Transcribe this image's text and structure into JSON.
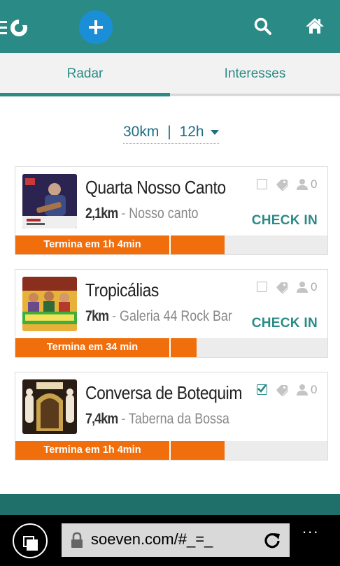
{
  "header": {
    "logo": "eventos-logo-icon",
    "add_icon": "plus-icon",
    "search_icon": "search-icon",
    "home_icon": "home-icon",
    "bar_color": "#2a8b86",
    "add_color": "#1a8fd8"
  },
  "tabs": [
    {
      "label": "Radar",
      "active": true
    },
    {
      "label": "Interesses",
      "active": false
    }
  ],
  "filter": {
    "distance": "30km",
    "separator": "|",
    "time": "12h"
  },
  "events": [
    {
      "title": "Quarta Nosso Canto",
      "distance": "2,1km",
      "separator": "-",
      "venue": "Nosso canto",
      "checked": false,
      "attendees": "0",
      "checkin_label": "CHECK IN",
      "time_left": "Termina em 1h 4min",
      "progress": 0.67
    },
    {
      "title": "Tropicálias",
      "distance": "7km",
      "separator": "-",
      "venue": "Galeria 44 Rock Bar",
      "checked": false,
      "attendees": "0",
      "checkin_label": "CHECK IN",
      "time_left": "Termina em 34 min",
      "progress": 0.58
    },
    {
      "title": "Conversa de Botequim",
      "distance": "7,4km",
      "separator": "-",
      "venue": "Taberna da Bossa",
      "checked": true,
      "attendees": "0",
      "time_left": "Termina em 1h 4min",
      "progress": 0.67
    }
  ],
  "browser": {
    "url": "soeven.com/#_=_",
    "more": "..."
  },
  "colors": {
    "accent": "#2a8b86",
    "progress": "#f06e0c",
    "track": "#ececec"
  }
}
